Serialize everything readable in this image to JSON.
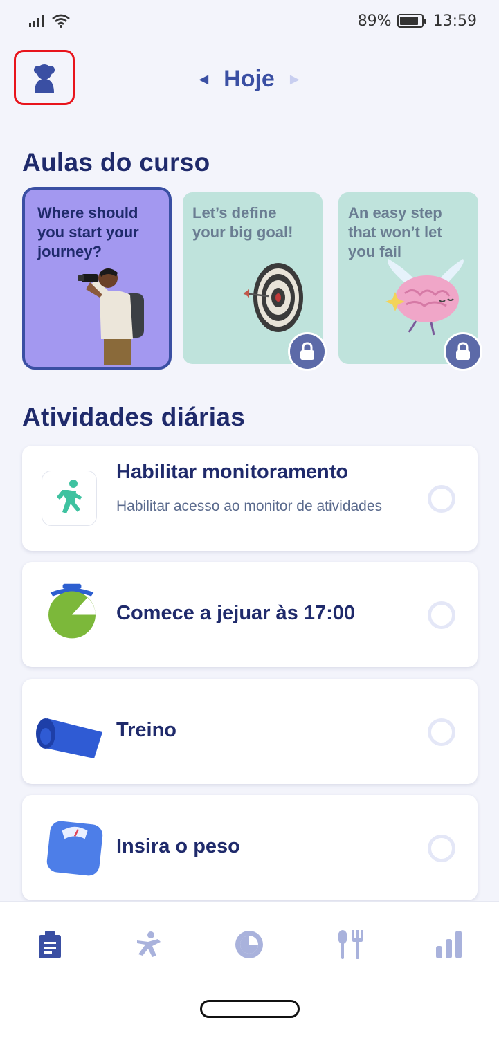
{
  "status_bar": {
    "battery": "89%",
    "battery_level": 0.89,
    "time": "13:59"
  },
  "header": {
    "profile_icon": "user-avatar-icon",
    "date_label": "Hoje",
    "prev_icon": "chevron-left-icon",
    "next_icon": "chevron-right-icon"
  },
  "course": {
    "section_title": "Aulas do curso",
    "cards": [
      {
        "title": "Where should you start your journey?",
        "locked": false,
        "art": "man-with-binoculars"
      },
      {
        "title": "Let’s define your big goal!",
        "locked": true,
        "art": "dartboard"
      },
      {
        "title": "An easy step that won’t let you fail",
        "locked": true,
        "art": "winged-brain"
      }
    ]
  },
  "daily": {
    "section_title": "Atividades diárias",
    "activities": [
      {
        "title": "Habilitar monitoramento",
        "subtitle": "Habilitar acesso ao monitor de atividades",
        "icon": "running-person-icon",
        "done": false
      },
      {
        "title": "Comece a jejuar às 17:00",
        "subtitle": "",
        "icon": "fasting-timer-icon",
        "done": false
      },
      {
        "title": "Treino",
        "subtitle": "",
        "icon": "yoga-mat-icon",
        "done": false
      },
      {
        "title": "Insira o peso",
        "subtitle": "",
        "icon": "scale-icon",
        "done": false
      }
    ]
  },
  "bottom_nav": {
    "items": [
      "clipboard-icon",
      "workout-icon",
      "fasting-icon",
      "meal-icon",
      "stats-icon"
    ],
    "active": 0
  },
  "colors": {
    "accent": "#3a4fa3",
    "dark_text": "#1f2a6b",
    "active_card": "#a398f0",
    "locked_card": "#bfe3dc",
    "profile_highlight": "#e8141c"
  }
}
